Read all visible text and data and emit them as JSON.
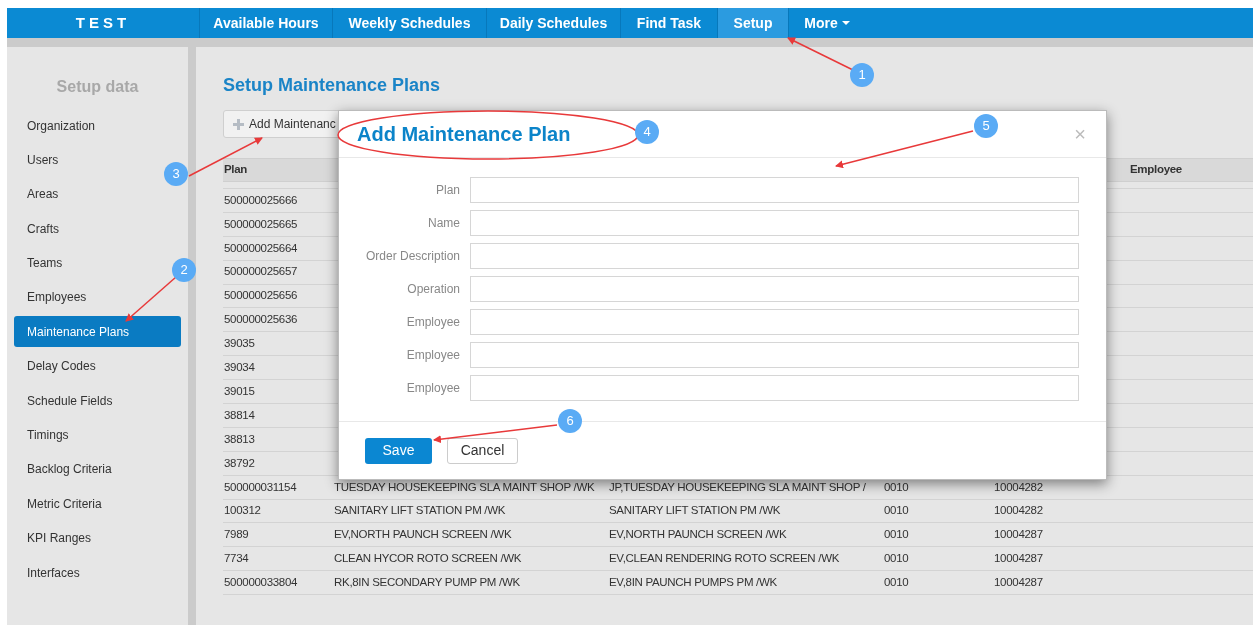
{
  "brand": "TEST",
  "nav": [
    {
      "label": "Available Hours",
      "selected": false
    },
    {
      "label": "Weekly Schedules",
      "selected": false
    },
    {
      "label": "Daily Schedules",
      "selected": false
    },
    {
      "label": "Find Task",
      "selected": false
    },
    {
      "label": "Setup",
      "selected": true
    },
    {
      "label": "More",
      "selected": false,
      "kind": "dropdown"
    }
  ],
  "sidebar": {
    "title": "Setup data",
    "items": [
      {
        "label": "Organization",
        "selected": false
      },
      {
        "label": "Users",
        "selected": false
      },
      {
        "label": "Areas",
        "selected": false
      },
      {
        "label": "Crafts",
        "selected": false
      },
      {
        "label": "Teams",
        "selected": false
      },
      {
        "label": "Employees",
        "selected": false
      },
      {
        "label": "Maintenance Plans",
        "selected": true
      },
      {
        "label": "Delay Codes",
        "selected": false
      },
      {
        "label": "Schedule Fields",
        "selected": false
      },
      {
        "label": "Timings",
        "selected": false
      },
      {
        "label": "Backlog Criteria",
        "selected": false
      },
      {
        "label": "Metric Criteria",
        "selected": false
      },
      {
        "label": "KPI Ranges",
        "selected": false
      },
      {
        "label": "Interfaces",
        "selected": false
      }
    ]
  },
  "page_title": "Setup Maintenance Plans",
  "add_button": "Add Maintenanc",
  "table": {
    "columns": [
      "Plan",
      "Employee"
    ],
    "rows": [
      [
        "500000025666"
      ],
      [
        "500000025665"
      ],
      [
        "500000025664"
      ],
      [
        "500000025657"
      ],
      [
        "500000025656"
      ],
      [
        "500000025636"
      ],
      [
        "39035"
      ],
      [
        "39034"
      ],
      [
        "39015"
      ],
      [
        "38814"
      ],
      [
        "38813"
      ],
      [
        "38792"
      ],
      [
        "500000031154",
        "TUESDAY HOUSEKEEPING SLA MAINT SHOP /WK",
        "JP,TUESDAY HOUSEKEEPING SLA MAINT SHOP /",
        "0010",
        "10004282"
      ],
      [
        "100312",
        "SANITARY LIFT STATION PM /WK",
        "SANITARY LIFT STATION PM /WK",
        "0010",
        "10004282"
      ],
      [
        "7989",
        "EV,NORTH PAUNCH SCREEN /WK",
        "EV,NORTH PAUNCH SCREEN /WK",
        "0010",
        "10004287"
      ],
      [
        "7734",
        "CLEAN HYCOR ROTO SCREEN /WK",
        "EV,CLEAN RENDERING ROTO SCREEN /WK",
        "0010",
        "10004287"
      ],
      [
        "500000033804",
        "RK,8IN SECONDARY PUMP PM /WK",
        "EV,8IN PAUNCH PUMPS PM /WK",
        "0010",
        "10004287"
      ]
    ]
  },
  "modal": {
    "title": "Add Maintenance Plan",
    "close": "×",
    "fields": [
      {
        "label": "Plan"
      },
      {
        "label": "Name"
      },
      {
        "label": "Order Description"
      },
      {
        "label": "Operation"
      },
      {
        "label": "Employee"
      },
      {
        "label": "Employee"
      },
      {
        "label": "Employee"
      }
    ],
    "buttons": [
      {
        "label": "Save",
        "kind": "primary"
      },
      {
        "label": "Cancel",
        "kind": "default"
      }
    ]
  },
  "annotations": [
    {
      "number": "1"
    },
    {
      "number": "2"
    },
    {
      "number": "3"
    },
    {
      "number": "4"
    },
    {
      "number": "5"
    },
    {
      "number": "6"
    }
  ]
}
